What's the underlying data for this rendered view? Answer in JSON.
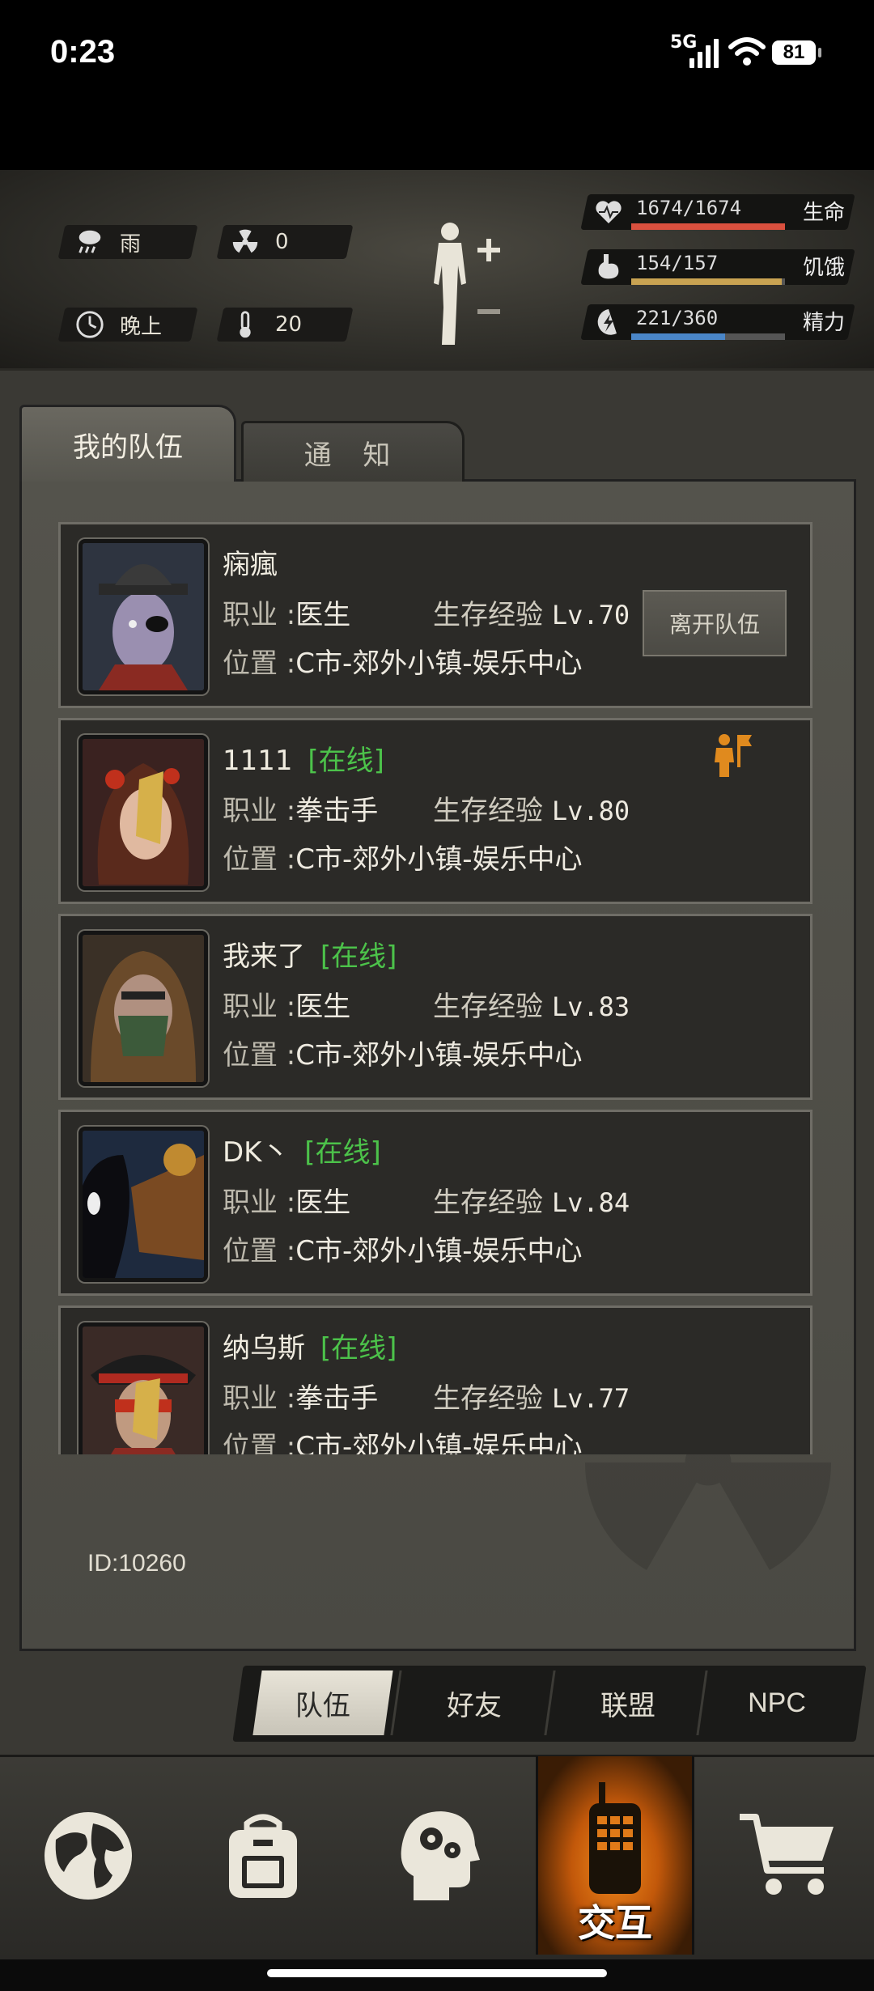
{
  "status_bar": {
    "time": "0:23",
    "network": "5G",
    "battery": "81"
  },
  "hud": {
    "weather": "雨",
    "radiation": "0",
    "time_of_day": "晚上",
    "temperature": "20",
    "stats": [
      {
        "label": "生命",
        "value": "1674/1674",
        "fraction": 1.0,
        "color": "#d9503e",
        "icon": "heart-pulse-icon"
      },
      {
        "label": "饥饿",
        "value": "154/157",
        "fraction": 0.98,
        "color": "#c9a352",
        "icon": "stomach-icon"
      },
      {
        "label": "精力",
        "value": "221/360",
        "fraction": 0.61,
        "color": "#4a86c8",
        "icon": "energy-bolt-icon"
      }
    ]
  },
  "tabs": {
    "active": "我的队伍",
    "inactive": "通 知"
  },
  "members": [
    {
      "name": "痫瘋",
      "status": "",
      "job_label": "职业",
      "job": "医生",
      "exp_label": "生存经验",
      "level": "Lv.70",
      "loc_label": "位置",
      "location": "C市-郊外小镇-娱乐中心",
      "action": "离开队伍"
    },
    {
      "name": "1111",
      "status": "[在线]",
      "job_label": "职业",
      "job": "拳击手",
      "exp_label": "生存经验",
      "level": "Lv.80",
      "loc_label": "位置",
      "location": "C市-郊外小镇-娱乐中心",
      "leader": true
    },
    {
      "name": "我来了",
      "status": "[在线]",
      "job_label": "职业",
      "job": "医生",
      "exp_label": "生存经验",
      "level": "Lv.83",
      "loc_label": "位置",
      "location": "C市-郊外小镇-娱乐中心"
    },
    {
      "name": "DK丶",
      "status": "[在线]",
      "job_label": "职业",
      "job": "医生",
      "exp_label": "生存经验",
      "level": "Lv.84",
      "loc_label": "位置",
      "location": "C市-郊外小镇-娱乐中心"
    },
    {
      "name": "纳乌斯",
      "status": "[在线]",
      "job_label": "职业",
      "job": "拳击手",
      "exp_label": "生存经验",
      "level": "Lv.77",
      "loc_label": "位置",
      "location": "C市-郊外小镇-娱乐中心"
    }
  ],
  "player_id": "ID:10260",
  "segments": [
    "队伍",
    "好友",
    "联盟",
    "NPC"
  ],
  "nav": {
    "active_label": "交互"
  }
}
